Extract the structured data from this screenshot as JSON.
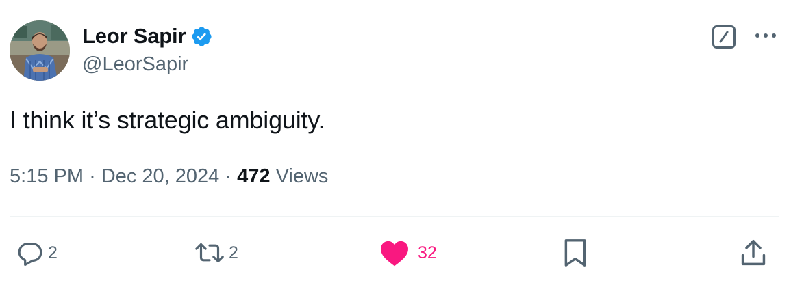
{
  "tweet": {
    "author": {
      "display_name": "Leor Sapir",
      "handle": "@LeorSapir",
      "avatar_icon": "profile-photo",
      "verified_icon": "verified-badge-icon",
      "verified_color": "#1d9bf0"
    },
    "text": "I think it’s strategic ambiguity.",
    "time": "5:15 PM",
    "separator": "·",
    "date": "Dec 20, 2024",
    "views_count": "472",
    "views_label": "Views"
  },
  "header_actions": {
    "grok_icon": "grok-icon",
    "more_icon": "more-dots-icon"
  },
  "actions": {
    "reply": {
      "icon": "reply-icon",
      "count": "2"
    },
    "retweet": {
      "icon": "retweet-icon",
      "count": "2"
    },
    "like": {
      "icon": "heart-icon",
      "count": "32",
      "color": "#f91880"
    },
    "bookmark": {
      "icon": "bookmark-icon"
    },
    "share": {
      "icon": "share-icon"
    }
  }
}
